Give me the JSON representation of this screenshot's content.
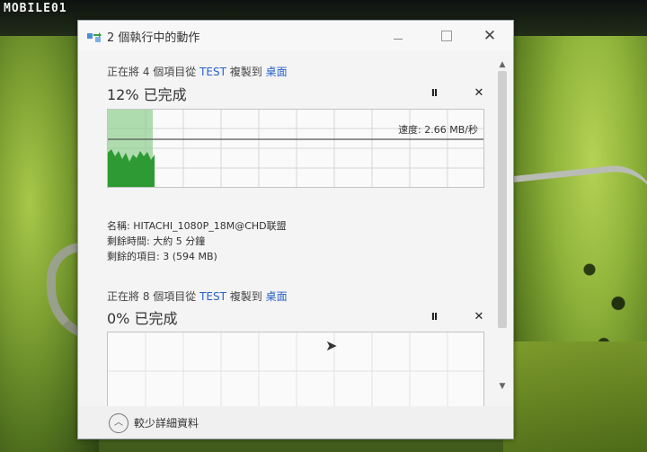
{
  "watermark": "MOBILE01",
  "window": {
    "title": "2 個執行中的動作"
  },
  "operations": [
    {
      "header_prefix": "正在將 4 個項目從 ",
      "source": "TEST",
      "middle": " 複製到 ",
      "destination": "桌面",
      "percent_text": "12% 已完成",
      "progress": 0.12,
      "speed_text": "速度: 2.66 MB/秒",
      "details": [
        "名稱: HITACHI_1080P_18M@CHD联盟",
        "剩餘時間: 大約 5 分鐘",
        "剩餘的項目: 3 (594 MB)"
      ],
      "pause_label": "II",
      "cancel_label": "✕"
    },
    {
      "header_prefix": "正在將 8 個項目從 ",
      "source": "TEST",
      "middle": " 複製到 ",
      "destination": "桌面",
      "percent_text": "0% 已完成",
      "progress": 0.0,
      "pause_label": "II",
      "cancel_label": "✕"
    }
  ],
  "footer": {
    "less_details_label": "較少詳細資料"
  },
  "colors": {
    "accent_link": "#2a62c9",
    "progress_fill": "#8fcf8f",
    "speed_graph": "#2e9a34"
  },
  "icons": {
    "title": "copy-arrows-icon",
    "pause": "pause-icon",
    "cancel": "close-icon",
    "less": "chevron-up-icon",
    "cursor": "mouse-cursor-icon"
  }
}
